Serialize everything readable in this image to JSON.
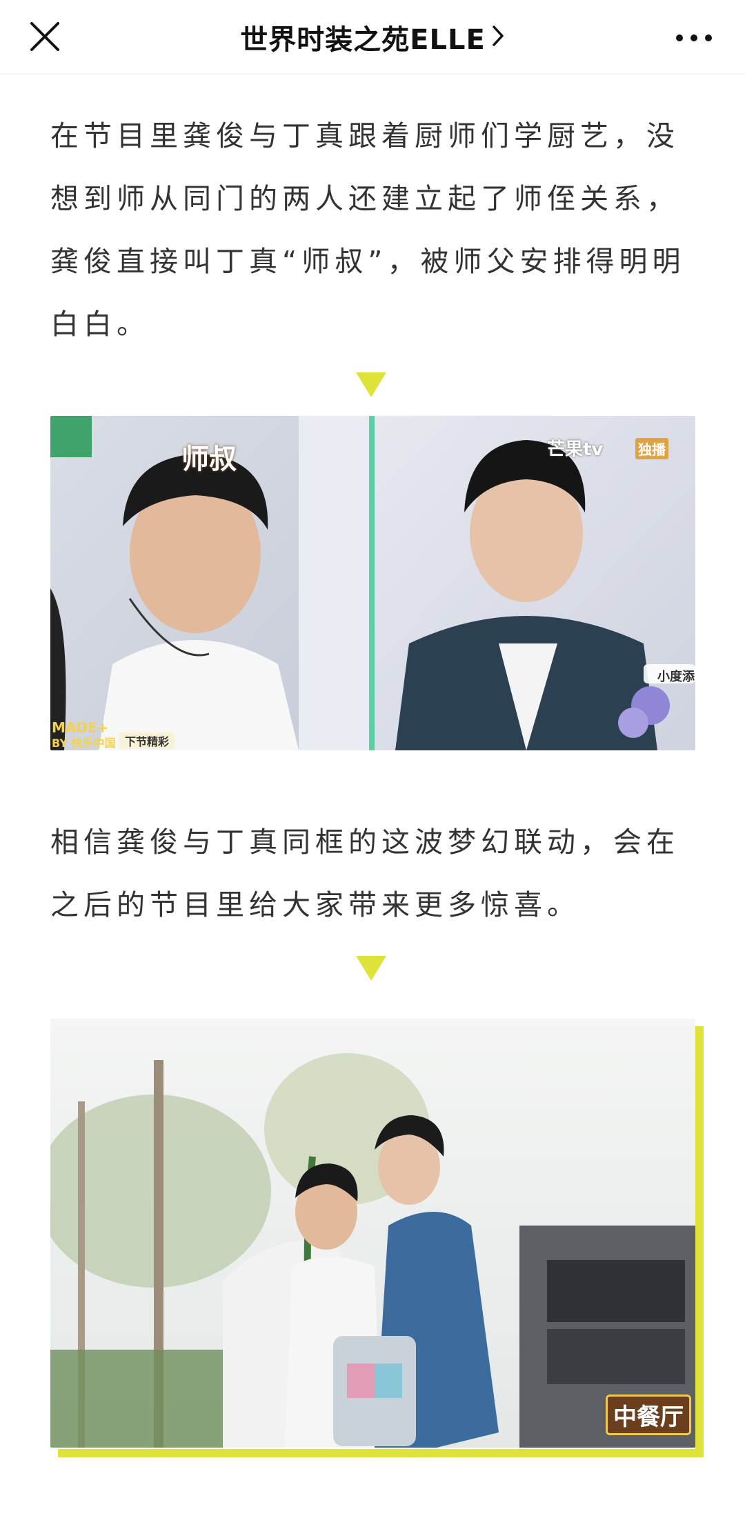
{
  "header": {
    "close_icon": "close-icon",
    "title": "世界时装之苑ELLE",
    "chevron_icon": "chevron-right-icon",
    "more_icon": "more-dots-icon"
  },
  "article": {
    "paragraph1": "在节目里龚俊与丁真跟着厨师们学厨艺，没想到师从同门的两人还建立起了师侄关系，龚俊直接叫丁真“师叔”，被师父安排得明明白白。",
    "paragraph2": "相信龚俊与丁真同框的这波梦幻联动，会在之后的节目里给大家带来更多惊喜。",
    "accent_color": "#dfe339",
    "image1": {
      "left_caption": "师叔",
      "right_watermark": "芒果tv",
      "right_tag": "独播",
      "bottom_logo_line1": "MADE+",
      "bottom_logo_line2": "BY 快乐中国",
      "bottom_tag": "下节精彩",
      "sponsor_tag": "小度添"
    },
    "image2": {
      "logo_text": "中餐厅"
    }
  }
}
